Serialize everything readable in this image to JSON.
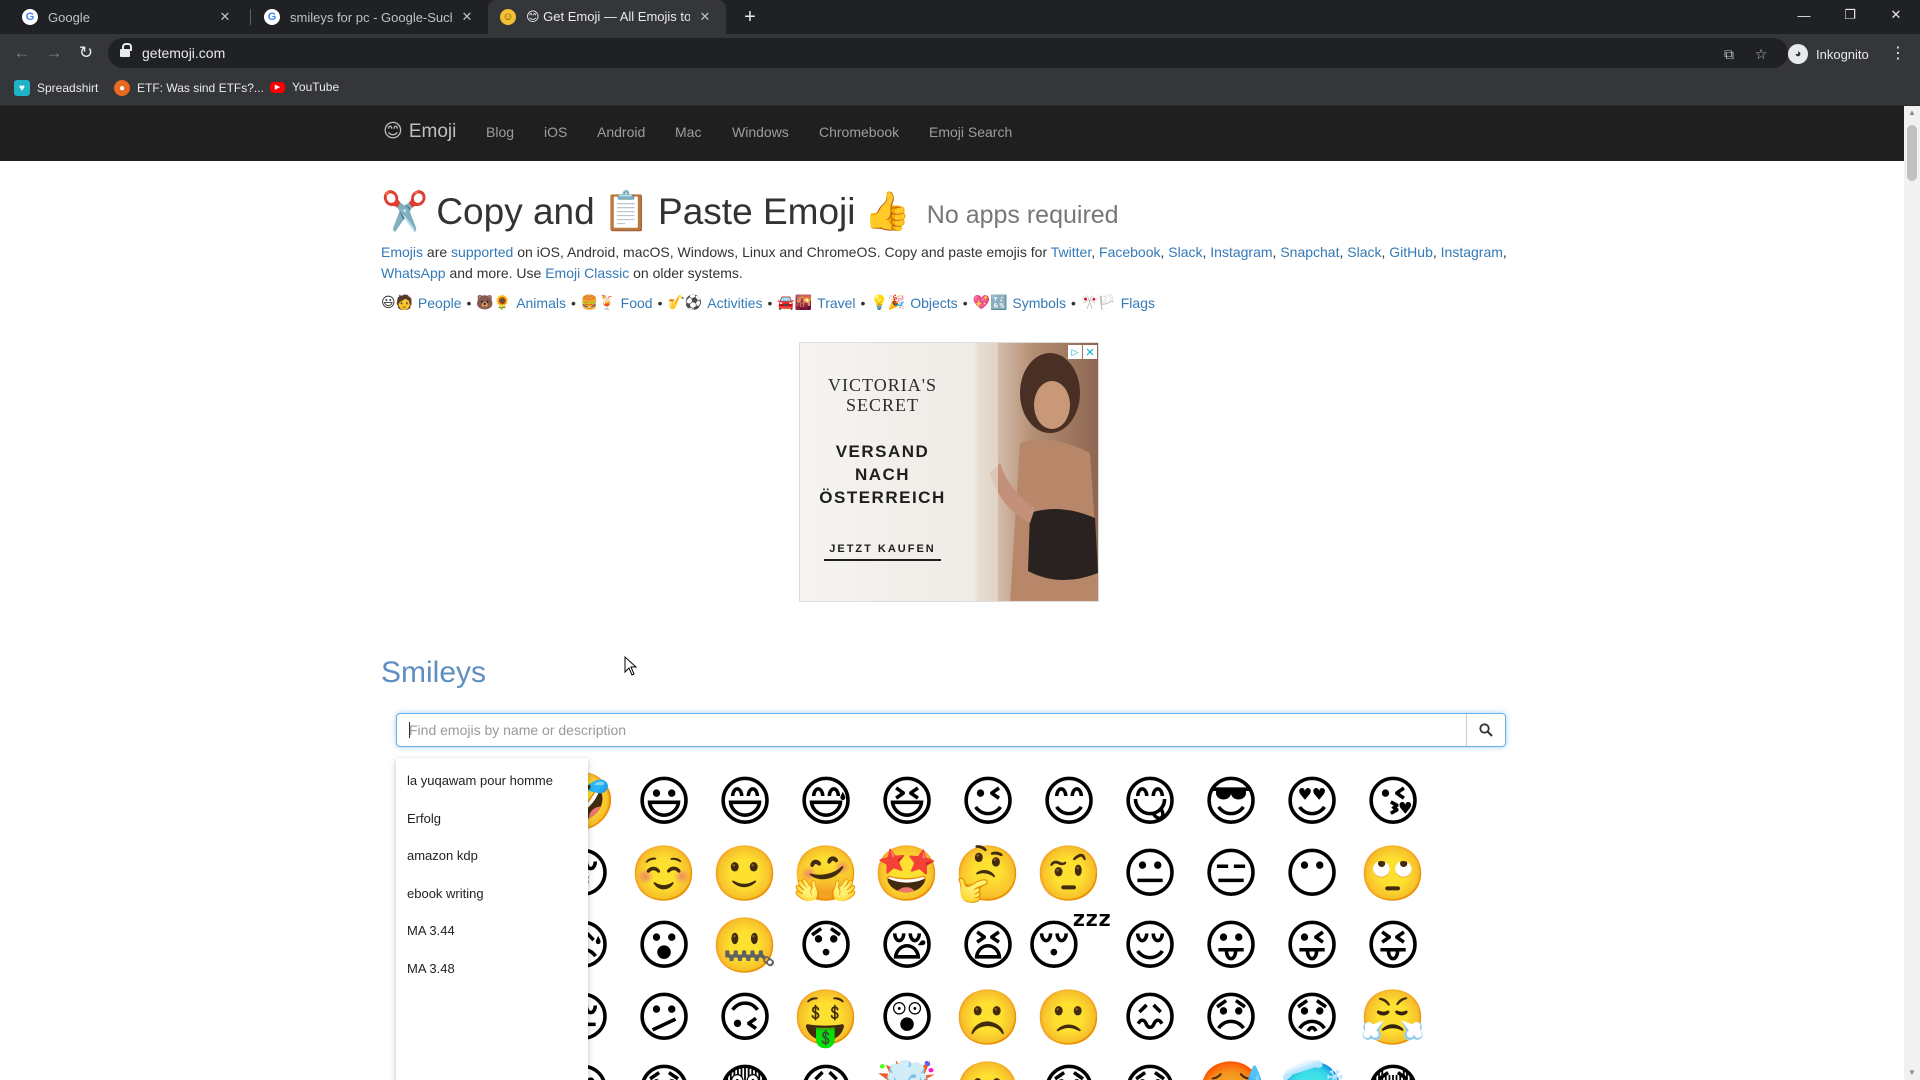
{
  "browser": {
    "tabs": [
      {
        "title": "Google",
        "favicon": "G"
      },
      {
        "title": "smileys for pc - Google-Suche",
        "favicon": "G"
      },
      {
        "title": "😊 Get Emoji — All Emojis to ✂️",
        "favicon": "😊"
      }
    ],
    "url": "getemoji.com",
    "profile": "Inkognito",
    "bookmarks": [
      {
        "label": "Spreadshirt",
        "color": "#20b3c7"
      },
      {
        "label": "ETF: Was sind ETFs?...",
        "color": "#e8691f"
      },
      {
        "label": "YouTube",
        "color": "#ff0000"
      }
    ]
  },
  "site": {
    "brand": "Emoji",
    "brand_icon": "😊",
    "nav": [
      "Blog",
      "iOS",
      "Android",
      "Mac",
      "Windows",
      "Chromebook",
      "Emoji Search"
    ]
  },
  "hero": {
    "scissors": "✂️",
    "word1": "Copy and",
    "clipboard": "📋",
    "word2": "Paste Emoji",
    "thumbs": "👍",
    "subtitle": "No apps required"
  },
  "intro": {
    "emojis": "Emojis",
    "are": "are",
    "supported": "supported",
    "on_text": "on iOS, Android, macOS, Windows, Linux and ChromeOS. Copy and paste emojis for",
    "services": [
      "Twitter",
      "Facebook",
      "Slack",
      "Instagram",
      "Snapchat",
      "Slack",
      "GitHub",
      "Instagram",
      "WhatsApp"
    ],
    "and_more": "and more. Use",
    "classic": "Emoji Classic",
    "older": "on older systems."
  },
  "categories": [
    {
      "emojis": "😃🧑",
      "label": "People"
    },
    {
      "emojis": "🐻🌻",
      "label": "Animals"
    },
    {
      "emojis": "🍔🍹",
      "label": "Food"
    },
    {
      "emojis": "🎷⚽",
      "label": "Activities"
    },
    {
      "emojis": "🚘🌇",
      "label": "Travel"
    },
    {
      "emojis": "💡🎉",
      "label": "Objects"
    },
    {
      "emojis": "💖🔣",
      "label": "Symbols"
    },
    {
      "emojis": "🎌🏳️",
      "label": "Flags"
    }
  ],
  "ad": {
    "brand_line1": "VICTORIA'S",
    "brand_line2": "SECRET",
    "head_line1": "VERSAND",
    "head_line2": "NACH",
    "head_line3": "ÖSTERREICH",
    "cta": "JETZT KAUFEN"
  },
  "smileys": {
    "title": "Smileys",
    "search_placeholder": "Find emojis by name or description",
    "rows": [
      [
        "😀",
        "😃",
        "🤣",
        "😃",
        "😄",
        "😅",
        "😆",
        "😉",
        "😊",
        "😋",
        "😎",
        "😍",
        "😘"
      ],
      [
        "😗",
        "😙",
        "😚",
        "☺️",
        "🙂",
        "🤗",
        "🤩",
        "🤔",
        "🤨",
        "😐",
        "😑",
        "😶",
        "🙄"
      ],
      [
        "😏",
        "😣",
        "😥",
        "😮",
        "🤐",
        "😯",
        "😪",
        "😫",
        "😴",
        "😌",
        "😛",
        "😜",
        "😝"
      ],
      [
        "😒",
        "😓",
        "😔",
        "😕",
        "🙃",
        "🤑",
        "😲",
        "☹️",
        "🙁",
        "😖",
        "😞",
        "😟",
        "😤"
      ],
      [
        "😢",
        "😭",
        "😦",
        "😧",
        "😨",
        "😩",
        "🤯",
        "😬",
        "😰",
        "😱",
        "🥵",
        "🥶",
        "😳"
      ]
    ]
  },
  "autocomplete": [
    "la yuqawam pour homme",
    "Erfolg",
    "amazon kdp",
    "ebook writing",
    "MA 3.44",
    "MA 3.48"
  ]
}
